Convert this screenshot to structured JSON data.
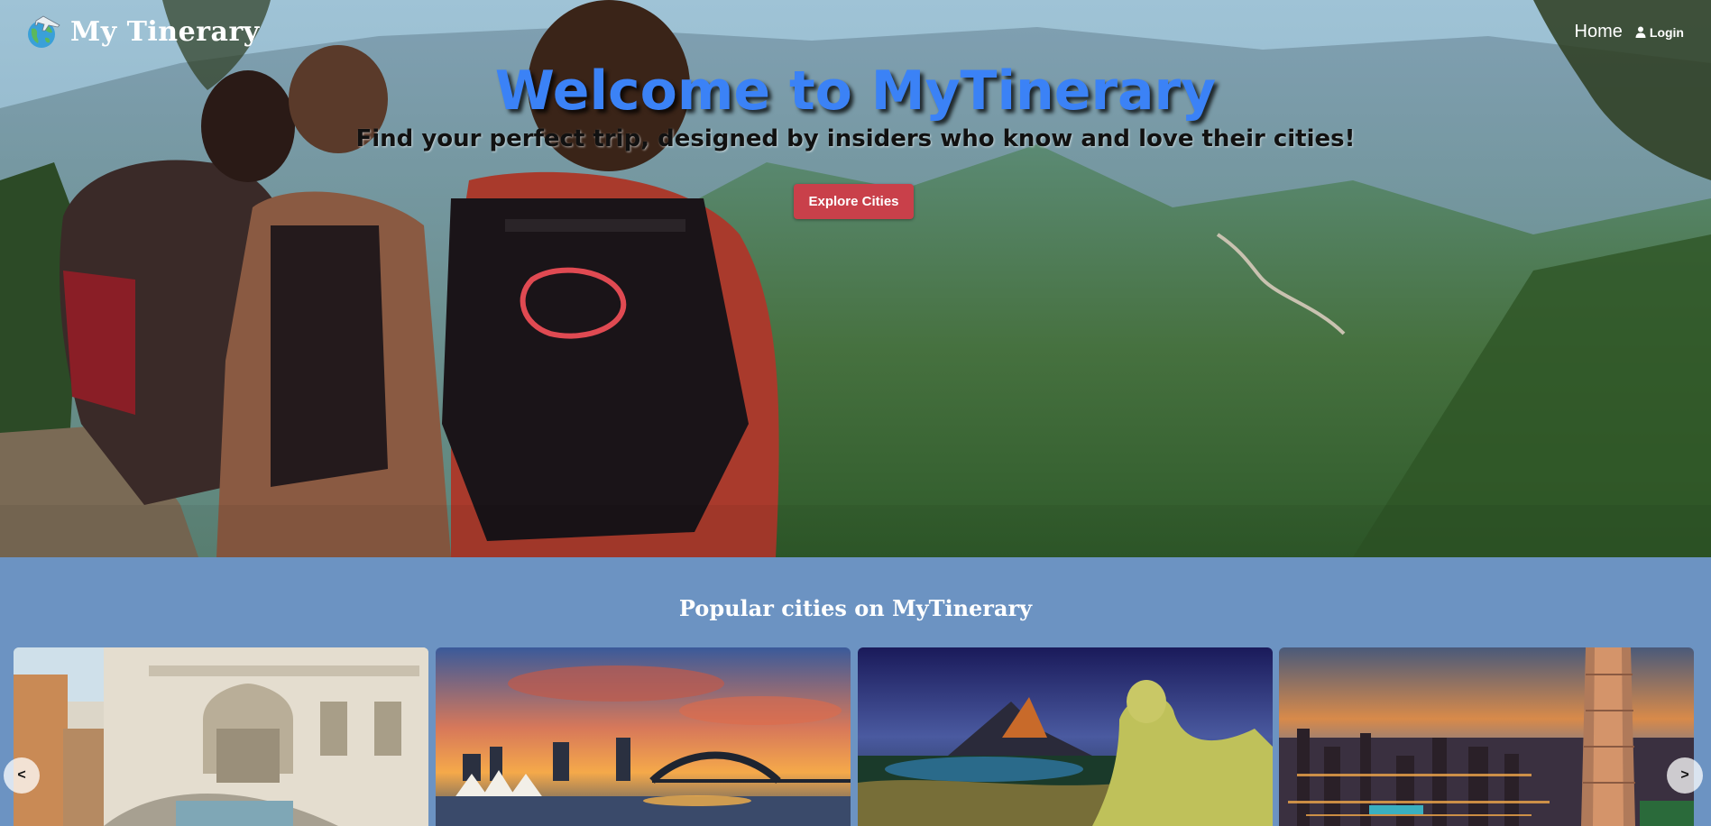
{
  "nav": {
    "brand": "My Tinerary",
    "home_label": "Home",
    "login_label": "Login",
    "logo_icon": "globe-airplane-icon",
    "user_icon": "user-icon"
  },
  "hero": {
    "title": "Welcome to MyTinerary",
    "subtitle": "Find your perfect trip, designed by insiders who know and love their cities!",
    "cta_label": "Explore Cities"
  },
  "popular": {
    "title": "Popular cities on MyTinerary",
    "prev_label": "<",
    "next_label": ">"
  },
  "colors": {
    "title_blue": "#3b82f6",
    "cta_red": "#c9404a",
    "section_bg": "#6c93c2"
  }
}
